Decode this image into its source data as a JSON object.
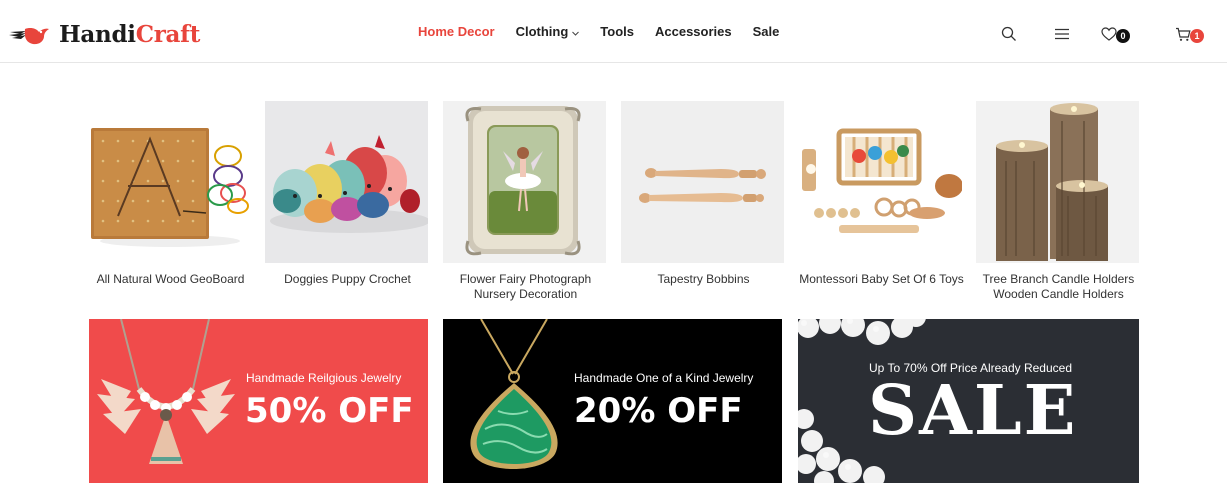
{
  "brand": {
    "name_dark": "Handi",
    "name_accent": "Craft",
    "accent_color": "#e8453c"
  },
  "nav": {
    "items": [
      {
        "label": "Home Decor",
        "active": true
      },
      {
        "label": "Clothing",
        "has_dropdown": true
      },
      {
        "label": "Tools"
      },
      {
        "label": "Accessories"
      },
      {
        "label": "Sale"
      }
    ]
  },
  "header_tools": {
    "search_icon": "search-icon",
    "menu_icon": "hamburger-menu-icon",
    "wishlist_count": "0",
    "cart_count": "1"
  },
  "products": [
    {
      "name": "All Natural Wood GeoBoard",
      "image": "geoboard"
    },
    {
      "name": "Doggies Puppy Crochet",
      "image": "crochet-dogs"
    },
    {
      "name": "Flower Fairy Photograph Nursery Decoration",
      "image": "fairy-photo-frame"
    },
    {
      "name": "Tapestry Bobbins",
      "image": "bobbins"
    },
    {
      "name": "Montessori Baby Set Of 6 Toys",
      "image": "montessori-toys"
    },
    {
      "name": "Tree Branch Candle Holders Wooden Candle Holders",
      "image": "tree-candle-holders"
    }
  ],
  "banners": [
    {
      "subtitle": "Handmade Reilgious Jewelry",
      "headline": "50% OFF",
      "bg_color": "#f04b4b",
      "image": "tassel-necklace"
    },
    {
      "subtitle": "Handmade One of a Kind Jewelry",
      "headline": "20% OFF",
      "bg_color": "#000000",
      "image": "malachite-pendant"
    },
    {
      "subtitle": "Up To 70% Off Price Already Reduced",
      "headline": "SALE",
      "bg_color": "#2a2d33",
      "image": "pearls"
    }
  ]
}
